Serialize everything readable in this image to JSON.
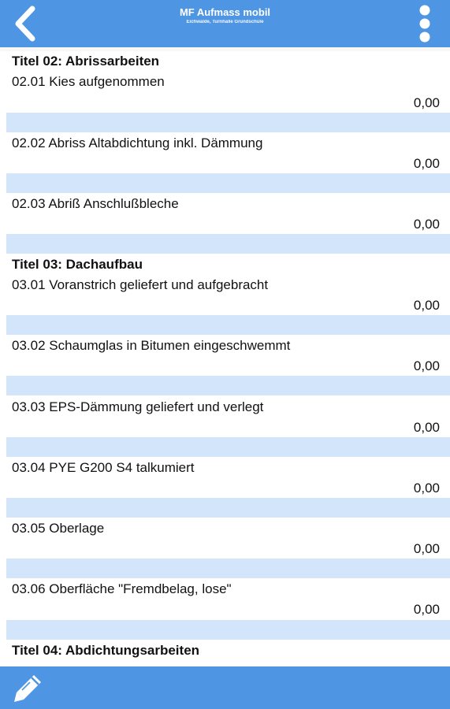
{
  "header": {
    "title": "MF Aufmass mobil",
    "subtitle": "Eichwalde, Turnhalle Grundschule",
    "back_icon": "chevron-left-icon",
    "menu_icon": "more-vertical-icon",
    "bar_color": "#4e95e3"
  },
  "sections": [
    {
      "title": "Titel 02: Abrissarbeiten",
      "items": [
        {
          "name": "02.01 Kies aufgenommen",
          "value": "0,00"
        },
        {
          "name": "02.02 Abriss Altabdichtung inkl. Dämmung",
          "value": "0,00"
        },
        {
          "name": "02.03 Abriß Anschlußbleche",
          "value": "0,00"
        }
      ]
    },
    {
      "title": "Titel 03: Dachaufbau",
      "items": [
        {
          "name": "03.01 Voranstrich geliefert und aufgebracht",
          "value": "0,00"
        },
        {
          "name": "03.02 Schaumglas in Bitumen eingeschwemmt",
          "value": "0,00"
        },
        {
          "name": "03.03 EPS-Dämmung geliefert und verlegt",
          "value": "0,00"
        },
        {
          "name": "03.04 PYE G200 S4 talkumiert",
          "value": "0,00"
        },
        {
          "name": "03.05 Oberlage",
          "value": "0,00"
        },
        {
          "name": "03.06 Oberfläche \"Fremdbelag, lose\"",
          "value": "0,00"
        }
      ]
    },
    {
      "title": "Titel 04: Abdichtungsarbeiten",
      "items": []
    }
  ],
  "footer": {
    "edit_icon": "pencil-icon",
    "separator_color": "#d3e5fa"
  }
}
